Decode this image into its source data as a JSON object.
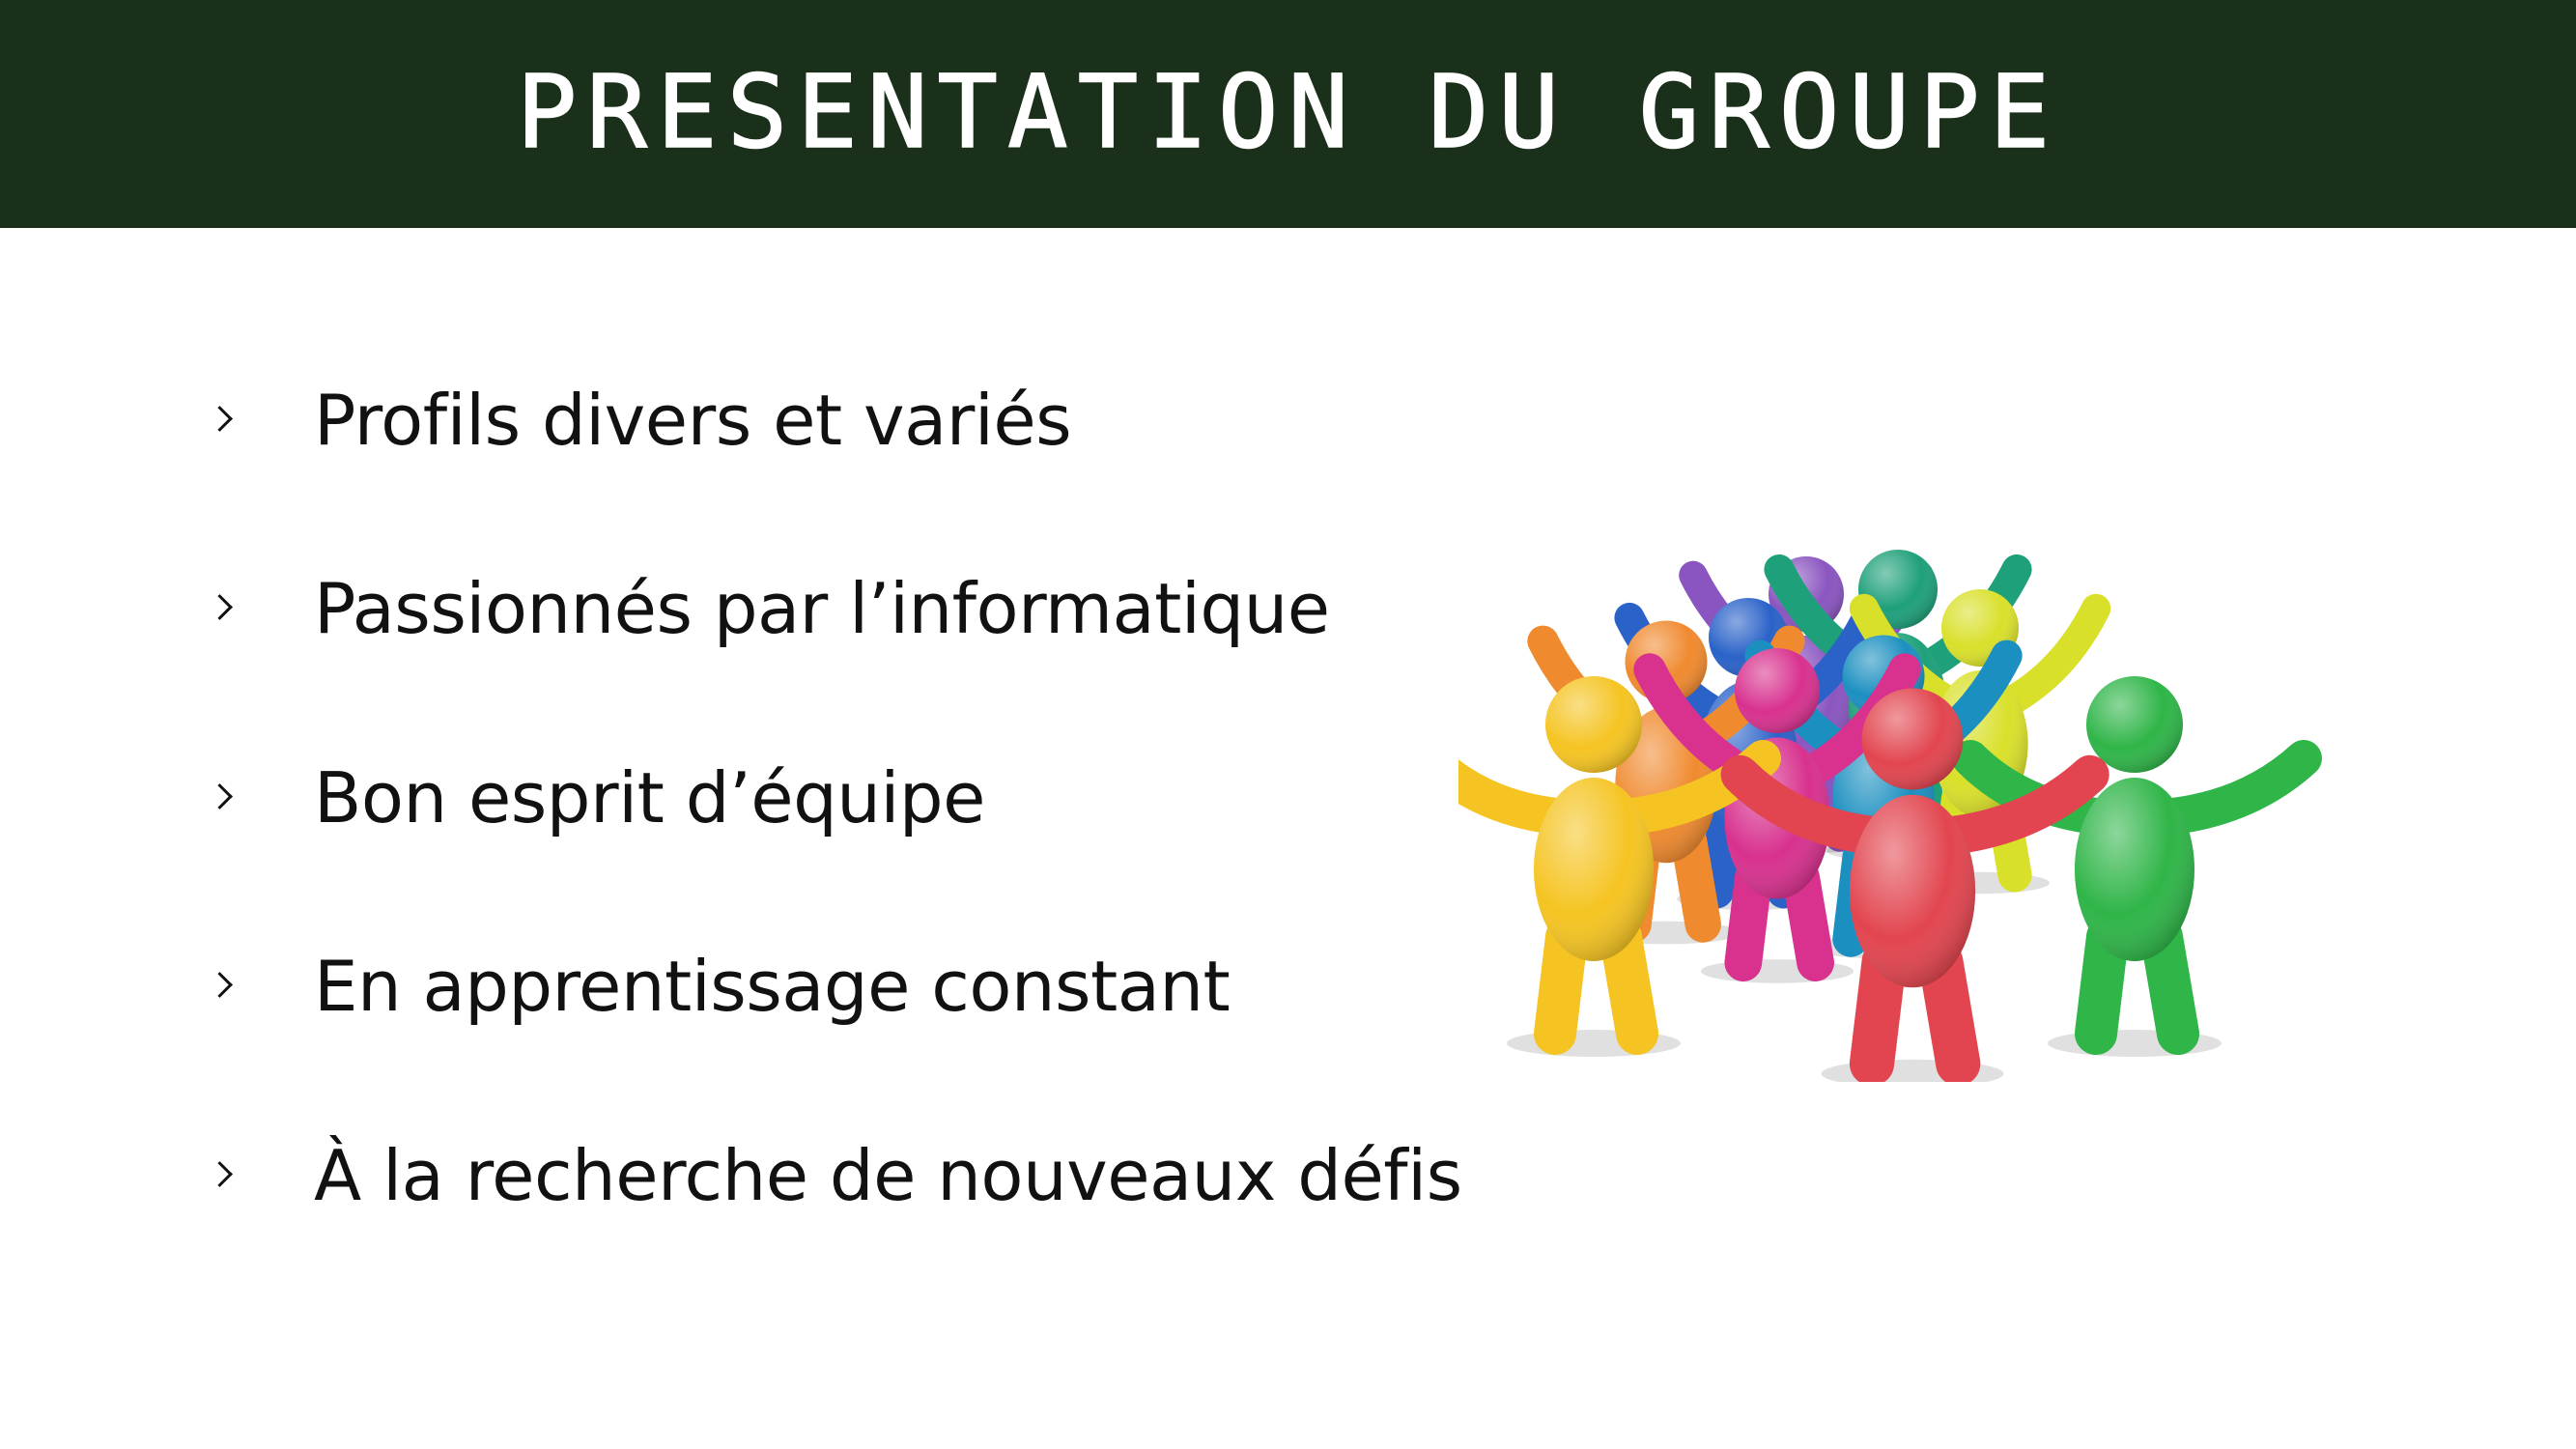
{
  "slide": {
    "title": "PRESENTATION DU GROUPE",
    "header_color": "#1a301b",
    "bullets": [
      "Profils divers et variés",
      "Passionnés par l’informatique",
      "Bon esprit d’équipe",
      "En apprentissage constant",
      "À la recherche de nouveaux défis"
    ],
    "illustration": {
      "icon": "team-figures-illustration",
      "figure_colors": [
        "#f5c422",
        "#d8318e",
        "#f08a2f",
        "#2a62c8",
        "#1ea07a",
        "#8a55c0",
        "#d9e02a",
        "#1b8fc0",
        "#e2454f",
        "#2fb548"
      ]
    }
  }
}
